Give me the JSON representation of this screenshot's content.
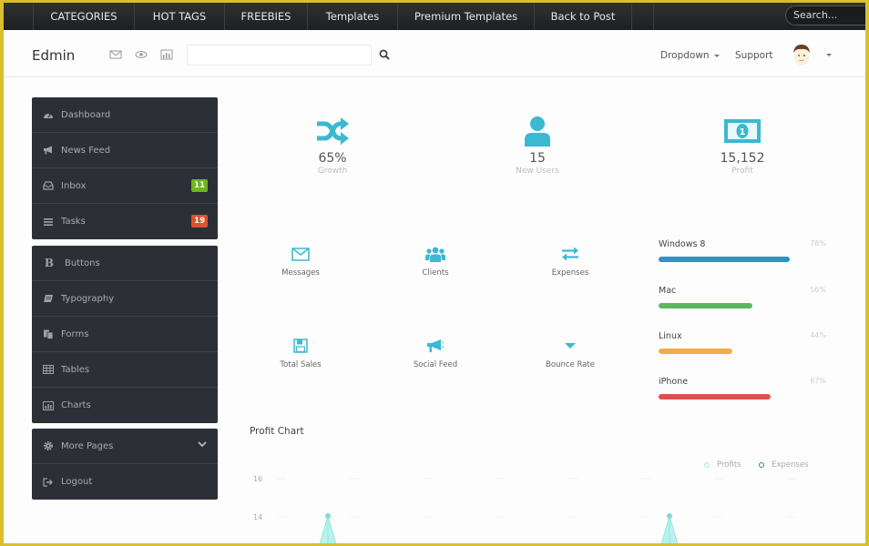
{
  "topnav": {
    "items": [
      "CATEGORIES",
      "HOT TAGS",
      "FREEBIES",
      "Templates",
      "Premium Templates",
      "Back to Post"
    ],
    "search_placeholder": "Search..."
  },
  "header": {
    "brand": "Edmin",
    "icons": [
      "envelope-icon",
      "eye-icon",
      "bar-chart-icon"
    ],
    "search_value": "",
    "search_placeholder": "",
    "dropdown_label": "Dropdown",
    "support_label": "Support"
  },
  "sidebar": {
    "group1": [
      {
        "label": "Dashboard",
        "icon": "dashboard-icon"
      },
      {
        "label": "News Feed",
        "icon": "bullhorn-icon"
      },
      {
        "label": "Inbox",
        "icon": "inbox-icon",
        "badge": "11",
        "badge_color": "#6cb71b"
      },
      {
        "label": "Tasks",
        "icon": "tasks-icon",
        "badge": "19",
        "badge_color": "#d9532b"
      }
    ],
    "group2": [
      {
        "label": "Buttons",
        "icon": "bold-icon"
      },
      {
        "label": "Typography",
        "icon": "book-icon"
      },
      {
        "label": "Forms",
        "icon": "paste-icon"
      },
      {
        "label": "Tables",
        "icon": "table-icon"
      },
      {
        "label": "Charts",
        "icon": "bar-chart-icon"
      }
    ],
    "group3": [
      {
        "label": "More Pages",
        "icon": "cog-icon"
      },
      {
        "label": "Logout",
        "icon": "signout-icon"
      }
    ]
  },
  "stats": [
    {
      "value": "65%",
      "caption": "Growth",
      "icon": "shuffle-icon"
    },
    {
      "value": "15",
      "caption": "New Users",
      "icon": "user-icon"
    },
    {
      "value": "15,152",
      "caption": "Profit",
      "icon": "money-icon"
    }
  ],
  "shortcuts": [
    {
      "label": "Messages",
      "icon": "envelope-icon"
    },
    {
      "label": "Clients",
      "icon": "group-icon"
    },
    {
      "label": "Expenses",
      "icon": "exchange-icon"
    },
    {
      "label": "Total Sales",
      "icon": "save-icon"
    },
    {
      "label": "Social Feed",
      "icon": "bullhorn-icon"
    },
    {
      "label": "Bounce Rate",
      "icon": "caret-down-icon"
    }
  ],
  "progress": [
    {
      "name": "Windows 8",
      "percent": 78,
      "label": "78%",
      "color": "#2a94c9"
    },
    {
      "name": "Mac",
      "percent": 56,
      "label": "56%",
      "color": "#5cb85c"
    },
    {
      "name": "Linux",
      "percent": 44,
      "label": "44%",
      "color": "#f0ad4e"
    },
    {
      "name": "iPhone",
      "percent": 67,
      "label": "67%",
      "color": "#d9534f"
    }
  ],
  "colors": {
    "accent": "#3ab9d1",
    "sidebar_bg": "#2d2f37",
    "topbar_bg": "#232426"
  },
  "profit_chart": {
    "title": "Profit Chart",
    "legend": [
      {
        "name": "Profits",
        "color": "#9fe8e0"
      },
      {
        "name": "Expenses",
        "color": "#2a8a85"
      }
    ],
    "y_ticks": [
      "16",
      "14"
    ],
    "y_visible_range": [
      13,
      17
    ]
  }
}
